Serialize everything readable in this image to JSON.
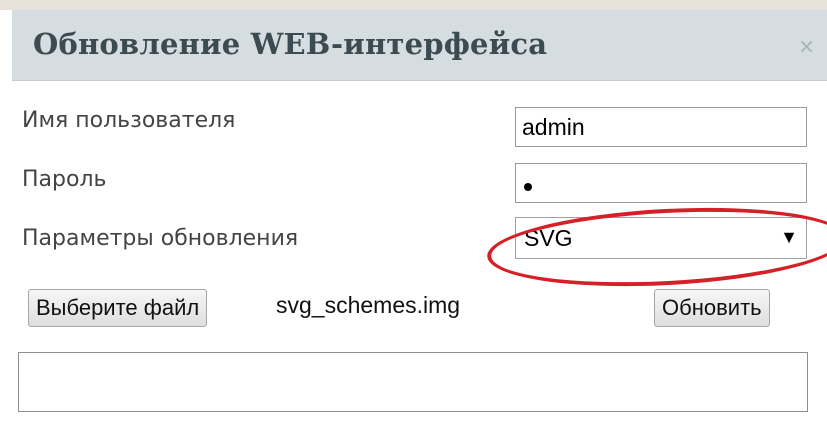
{
  "dialog": {
    "title": "Обновление WEB-интерфейса",
    "close_label": "×"
  },
  "form": {
    "username_label": "Имя пользователя",
    "username_value": "admin",
    "password_label": "Пароль",
    "update_params_label": "Параметры обновления",
    "update_params_selected": "SVG",
    "select_arrow": "▼"
  },
  "file": {
    "choose_button": "Выберите файл",
    "file_name": "svg_schemes.img"
  },
  "actions": {
    "update_button": "Обновить"
  },
  "colors": {
    "annotation_circle": "#d61f26",
    "title_bar": "#d6dde0"
  }
}
